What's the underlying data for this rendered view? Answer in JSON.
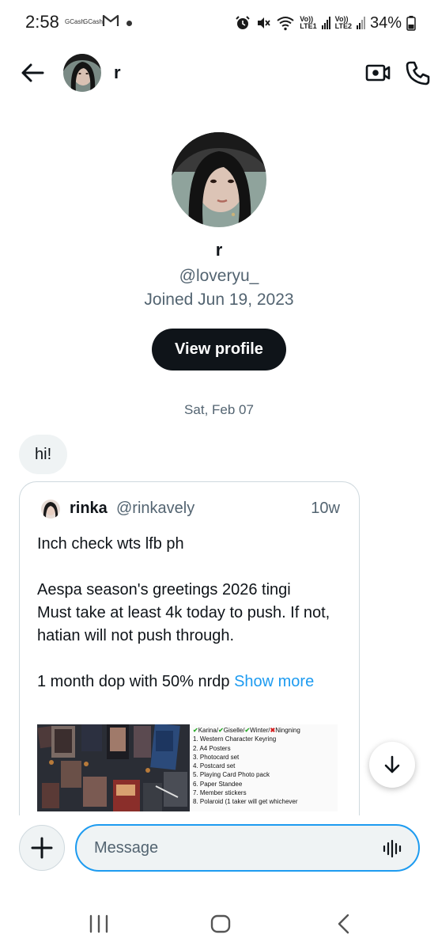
{
  "status_bar": {
    "time": "2:58",
    "app1": "GCash",
    "app2": "GCash",
    "sim1_label_top": "Vo))",
    "sim1_label_bottom": "LTE1",
    "sim2_label_top": "Vo))",
    "sim2_label_bottom": "LTE2",
    "battery": "34%"
  },
  "header": {
    "name": "r",
    "icons": [
      "back-arrow-icon",
      "video-camera-icon",
      "phone-icon"
    ]
  },
  "profile": {
    "name": "r",
    "handle": "@loveryu_",
    "joined": "Joined Jun 19, 2023",
    "view_profile_label": "View profile"
  },
  "conversation": {
    "date_separator": "Sat, Feb 07",
    "message_text": "hi!"
  },
  "quoted_tweet": {
    "author_name": "rinka",
    "author_handle": "@rinkavely",
    "time": "10w",
    "line1": "Inch check wts lfb ph",
    "line2": "Aespa season's greetings 2026 tingi",
    "line3": "Must take at least 4k today to push. If not, hatian will not push through.",
    "line4": "1 month dop with 50% nrdp",
    "show_more": "Show more",
    "media_members": {
      "m1": "Karina/",
      "m2": "Giselle/",
      "m3": "Winter/",
      "m4": "Ningning"
    },
    "media_list": [
      "1. Western Character Keyring",
      "2. A4 Posters",
      "3. Photocard set",
      "4. Postcard set",
      "5. Playing Card Photo pack",
      "6. Paper Standee",
      "7. Member stickers",
      "8. Polaroid (1 taker will get whichever"
    ]
  },
  "composer": {
    "placeholder": "Message"
  },
  "colors": {
    "accent": "#1d9bf0",
    "text_primary": "#0f1419",
    "text_secondary": "#536471",
    "bubble_bg": "#eff3f4"
  }
}
